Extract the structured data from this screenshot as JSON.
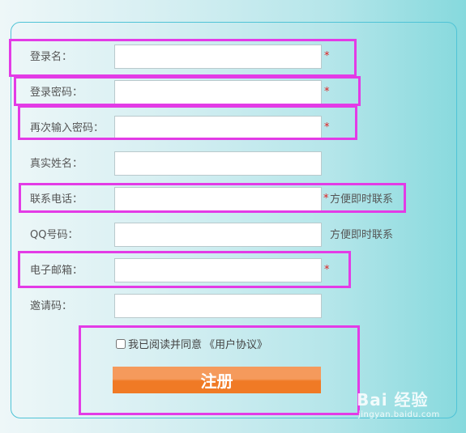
{
  "form": {
    "fields": [
      {
        "label": "登录名：",
        "value": "",
        "required": true,
        "hint": ""
      },
      {
        "label": "登录密码：",
        "value": "",
        "required": true,
        "hint": ""
      },
      {
        "label": "再次输入密码：",
        "value": "",
        "required": true,
        "hint": ""
      },
      {
        "label": "真实姓名：",
        "value": "",
        "required": false,
        "hint": ""
      },
      {
        "label": "联系电话：",
        "value": "",
        "required": true,
        "hint": "方便即时联系"
      },
      {
        "label": "QQ号码：",
        "value": "",
        "required": false,
        "hint": "方便即时联系"
      },
      {
        "label": "电子邮箱：",
        "value": "",
        "required": true,
        "hint": ""
      },
      {
        "label": "邀请码：",
        "value": "",
        "required": false,
        "hint": ""
      }
    ],
    "required_mark": "*",
    "agreement": {
      "checked": false,
      "text": "我已阅读并同意",
      "link": "《用户协议》"
    },
    "submit_label": "注册"
  },
  "watermark": {
    "main": "Bai 经验",
    "sub": "jingyan.baidu.com"
  },
  "colors": {
    "highlight": "#e33be6",
    "required": "#e02020",
    "submit": "#f07a25",
    "panel_border": "#4fc3d6"
  }
}
